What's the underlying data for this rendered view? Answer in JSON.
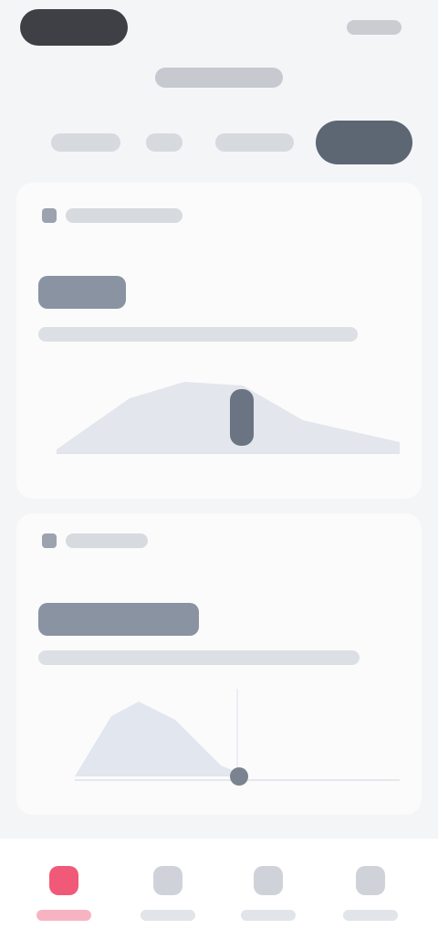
{
  "header": {
    "title": ""
  },
  "tabs": [
    {
      "label": ""
    },
    {
      "label": ""
    },
    {
      "label": ""
    },
    {
      "label": "",
      "active": true
    }
  ],
  "cards": [
    {
      "tag": "",
      "value": "",
      "subtitle": ""
    },
    {
      "tag": "",
      "value": "",
      "subtitle": ""
    }
  ],
  "bottom_nav": [
    {
      "label": "",
      "icon": "home-icon",
      "active": true
    },
    {
      "label": "",
      "icon": "chart-icon"
    },
    {
      "label": "",
      "icon": "user-icon"
    },
    {
      "label": "",
      "icon": "settings-icon"
    }
  ],
  "colors": {
    "accent": "#f05a78",
    "active_tab": "#5d6673",
    "background": "#f4f5f7",
    "card": "#fbfbfc"
  }
}
